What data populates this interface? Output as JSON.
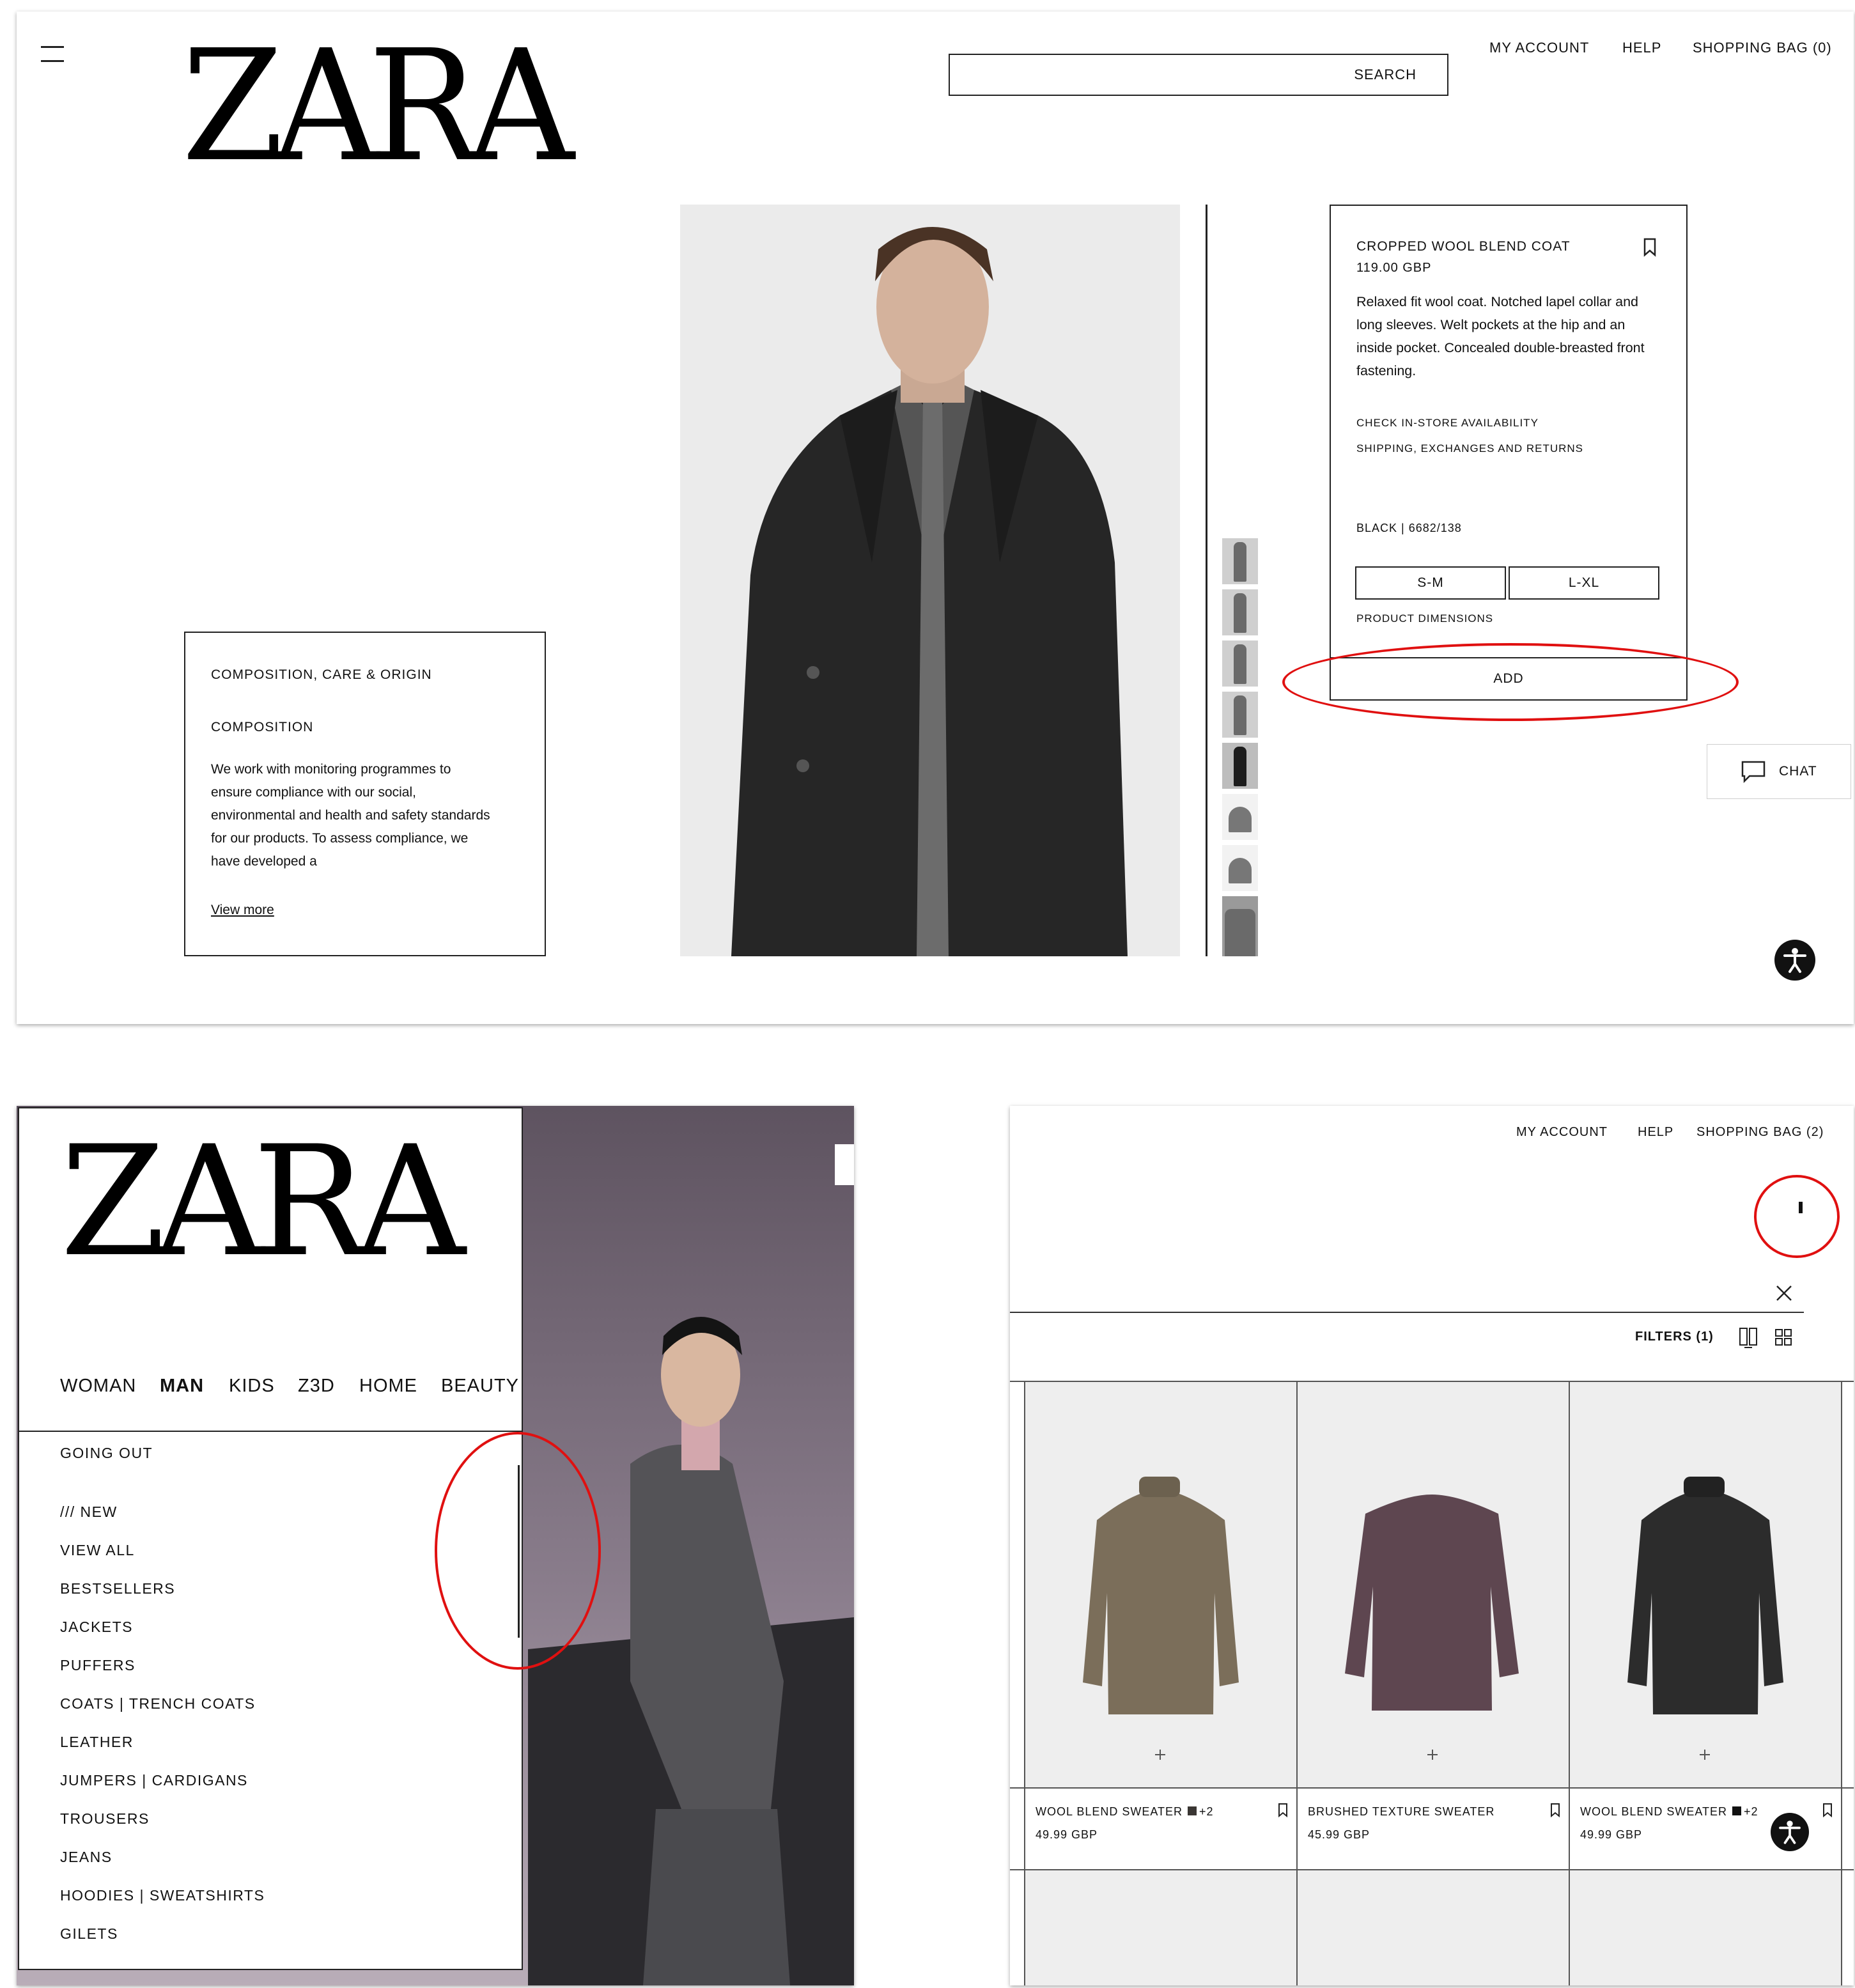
{
  "panel1": {
    "logo": "ZARA",
    "search": {
      "label": "SEARCH"
    },
    "nav": {
      "account": "MY ACCOUNT",
      "help": "HELP",
      "bag": "SHOPPING BAG (0)"
    },
    "product": {
      "name": "CROPPED WOOL BLEND COAT",
      "price": "119.00 GBP",
      "description": "Relaxed fit wool coat. Notched lapel collar and long sleeves. Welt pockets at the hip and an inside pocket. Concealed double-breasted front fastening.",
      "store_link": "CHECK IN-STORE AVAILABILITY",
      "shipping_link": "SHIPPING, EXCHANGES AND RETURNS",
      "color": "BLACK | 6682/138",
      "sizes": [
        "S-M",
        "L-XL"
      ],
      "dimensions_link": "PRODUCT DIMENSIONS",
      "add_label": "ADD"
    },
    "composition": {
      "title": "COMPOSITION, CARE & ORIGIN",
      "subtitle": "COMPOSITION",
      "body": "We work with monitoring programmes to ensure compliance with our social, environmental and health and safety standards for our products. To assess compliance, we have developed a",
      "view_more": "View more"
    },
    "chat_label": "CHAT"
  },
  "panel2": {
    "logo": "ZARA",
    "categories": [
      "WOMAN",
      "MAN",
      "KIDS",
      "Z3D",
      "HOME",
      "BEAUTY"
    ],
    "active_category": "MAN",
    "menu_items": [
      "GOING OUT",
      "/// NEW",
      "VIEW ALL",
      "BESTSELLERS",
      "JACKETS",
      "PUFFERS",
      "COATS | TRENCH COATS",
      "LEATHER",
      "JUMPERS | CARDIGANS",
      "TROUSERS",
      "JEANS",
      "HOODIES | SWEATSHIRTS",
      "GILETS"
    ]
  },
  "panel3": {
    "nav": {
      "account": "MY ACCOUNT",
      "help": "HELP",
      "bag": "SHOPPING BAG (2)"
    },
    "filters_label": "FILTERS (1)",
    "products": [
      {
        "name": "WOOL BLEND SWEATER",
        "swatch": "#3a3633",
        "extra": "+2",
        "price": "49.99 GBP",
        "garment_color": "#7b6e5a"
      },
      {
        "name": "BRUSHED TEXTURE SWEATER",
        "price": "45.99 GBP",
        "garment_color": "#5e4650"
      },
      {
        "name": "WOOL BLEND SWEATER",
        "swatch": "#111111",
        "extra": "+2",
        "price": "49.99 GBP",
        "garment_color": "#2c2c2c"
      }
    ]
  },
  "colors": {
    "highlight": "#e01010",
    "text": "#111111"
  }
}
